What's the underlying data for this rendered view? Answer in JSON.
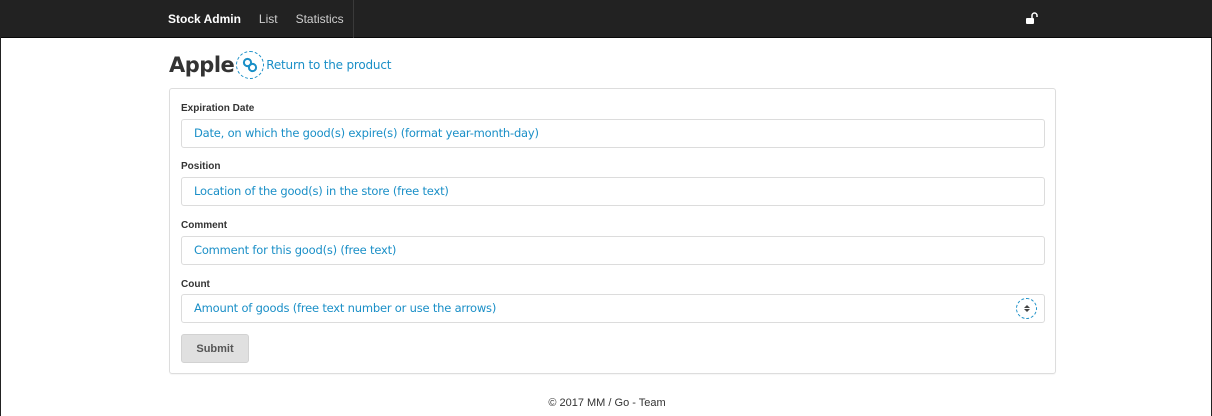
{
  "navbar": {
    "brand": "Stock Admin",
    "items": [
      {
        "label": "List"
      },
      {
        "label": "Statistics"
      }
    ],
    "lock_icon": "unlock-icon"
  },
  "header": {
    "title": "Apple",
    "link_icon": "link-icon",
    "return_link": "Return to the product"
  },
  "form": {
    "fields": [
      {
        "label": "Expiration Date",
        "placeholder": "Date, on which the good(s) expire(s) (format year-month-day)"
      },
      {
        "label": "Position",
        "placeholder": "Location of the good(s) in the store (free text)"
      },
      {
        "label": "Comment",
        "placeholder": "Comment for this good(s) (free text)"
      },
      {
        "label": "Count",
        "placeholder": "Amount of goods (free text number or use the arrows)"
      }
    ],
    "submit_label": "Submit"
  },
  "footer": {
    "text": "© 2017 MM / Go - Team"
  },
  "colors": {
    "navbar_bg": "#222222",
    "accent": "#1a8fc7"
  }
}
